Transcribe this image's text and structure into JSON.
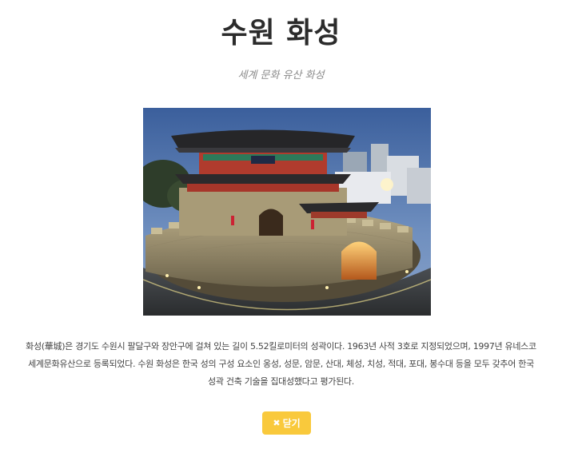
{
  "modal": {
    "title": "수원 화성",
    "subtitle": "세계 문화 유산 화성",
    "image_alt": "팔달문",
    "sign_text": "八達門",
    "description": "화성(華城)은 경기도 수원시 팔달구와 장안구에 걸쳐 있는 길이 5.52킬로미터의 성곽이다. 1963년 사적 3호로 지정되었으며, 1997년 유네스코 세계문화유산으로 등록되었다. 수원 화성은 한국 성의 구성 요소인 옹성, 성문, 암문, 산대, 체성, 치성, 적대, 포대, 봉수대 등을 모두 갖추어 한국 성곽 건축 기술을 집대성했다고 평가된다.",
    "close_button": {
      "icon": "close-icon",
      "icon_glyph": "✖",
      "label": "닫기"
    }
  },
  "colors": {
    "button": "#f9c93c",
    "title": "#2b2b2b",
    "subtitle": "#8a8a8a",
    "text": "#444444"
  }
}
